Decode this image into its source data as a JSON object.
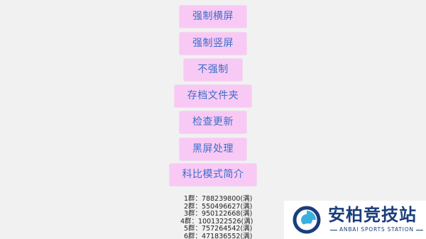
{
  "menu": {
    "buttons": [
      {
        "id": "force-landscape",
        "label": "强制横屏"
      },
      {
        "id": "force-portrait",
        "label": "强制竖屏"
      },
      {
        "id": "no-force",
        "label": "不强制"
      },
      {
        "id": "save-folder",
        "label": "存档文件夹"
      },
      {
        "id": "check-update",
        "label": "检查更新"
      },
      {
        "id": "black-screen",
        "label": "黑屏处理"
      },
      {
        "id": "kebi-mode",
        "label": "科比模式简介"
      }
    ]
  },
  "groups": [
    "1群：788239800(满)",
    "2群：550496627(满)",
    "3群：950122668(满)",
    "4群：1001322526(满)",
    "5群：757264542(满)",
    "6群：471836552(满)"
  ],
  "logo": {
    "title": "安柏竞技站",
    "subtitle": "ANBAI SPORTS STATION",
    "color": "#1a3d7c",
    "accent": "#3bb0e0"
  },
  "colors": {
    "background": "#f1f1f1",
    "button_bg": "#f9c9f5",
    "button_text": "#3a6fc8"
  }
}
